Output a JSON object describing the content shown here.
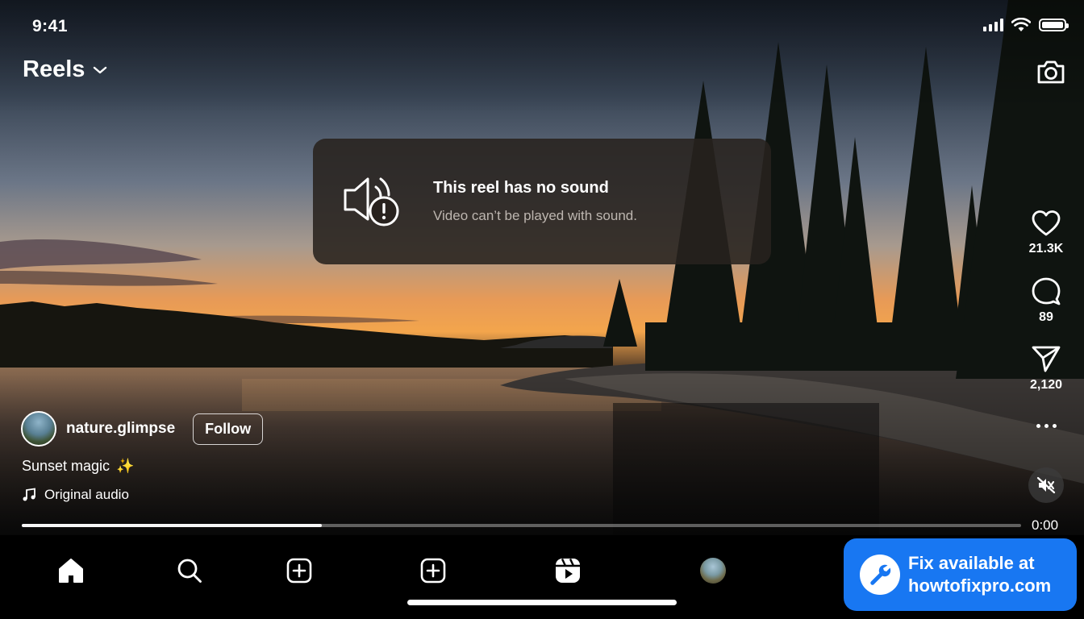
{
  "status_bar": {
    "time": "9:41"
  },
  "header": {
    "title": "Reels",
    "dropdown_icon": "chevron-down-icon",
    "camera_icon": "camera-icon"
  },
  "toast": {
    "icon": "speaker-alert-icon",
    "title": "This reel has no sound",
    "subtitle": "Video can’t be played with sound."
  },
  "actions": {
    "likes": "21.3K",
    "comments": "89",
    "shares": "2,120"
  },
  "post": {
    "username": "nature.glimpse",
    "follow_label": "Follow",
    "caption": "Sunset magic",
    "caption_emoji": "✨",
    "audio": "Original audio"
  },
  "player": {
    "time": "0:00",
    "progress": 0.3
  },
  "nav": {
    "items": [
      "home-icon",
      "search-icon",
      "create-icon",
      "create-icon",
      "reels-icon",
      "profile-avatar"
    ]
  },
  "promo": {
    "line1": "Fix available at",
    "line2": "howtofixpro.com"
  },
  "colors": {
    "accent": "#1877f2",
    "toast_bg": "#28221e"
  }
}
